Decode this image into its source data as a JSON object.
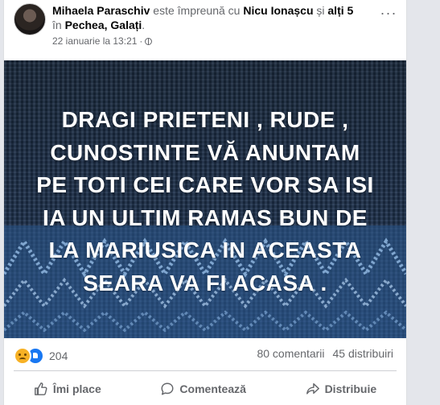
{
  "post": {
    "author": "Mihaela Paraschiv",
    "with_text": " este împreună cu ",
    "tagged": "Nicu Ionașcu",
    "and_text": " și ",
    "others": "alți 5",
    "in_text": " în ",
    "location": "Pechea, Galați",
    "location_suffix": ".",
    "date": "22 ianuarie la 13:21",
    "dot": "·",
    "image_text": "DRAGI PRIETENI , RUDE ,\nCUNOSTINTE VĂ ANUNTAM\nPE TOTI CEI CARE VOR SA ISI\nIA UN ULTIM RAMAS BUN DE\nLA MARIUSICA IN ACEASTA\nSEARA VA FI ACASA ."
  },
  "stats": {
    "reaction_count": "204",
    "comments": "80 comentarii",
    "shares": "45 distribuiri"
  },
  "actions": {
    "like": "Îmi place",
    "comment": "Comentează",
    "share": "Distribuie"
  },
  "icons": {
    "reactions": [
      "sad-icon",
      "like-icon"
    ],
    "privacy": "globe-icon",
    "more": "more-options-icon"
  },
  "colors": {
    "like_blue": "#1877f2",
    "sad_yellow": "#f7b125",
    "text_secondary": "#65676b",
    "image_bg": "#1f3350"
  }
}
